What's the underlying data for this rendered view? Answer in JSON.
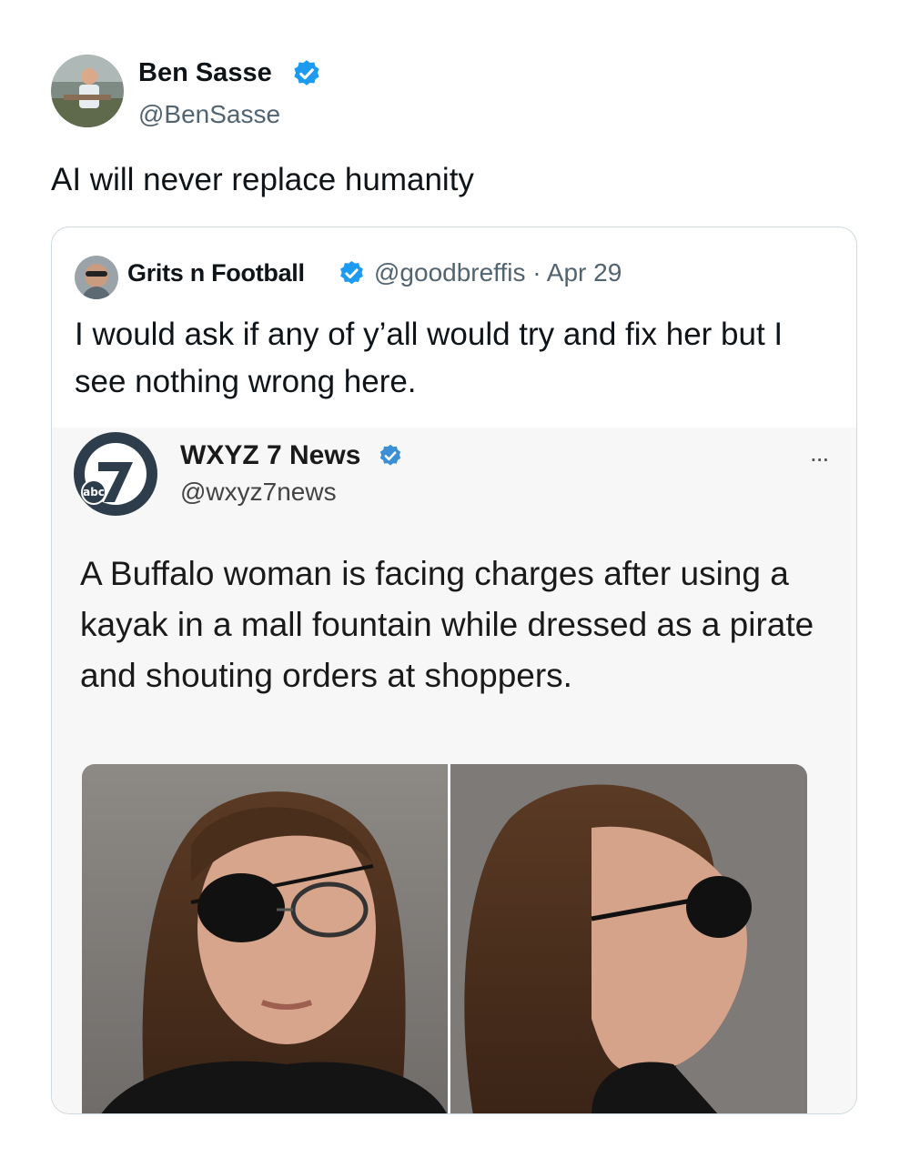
{
  "tweet": {
    "author_name": "Ben Sasse",
    "author_handle": "@BenSasse",
    "text": "AI will never replace humanity",
    "verified_color": "#1d9bf0"
  },
  "quoted_tweet": {
    "author_name": "Grits n Football",
    "handle_and_date": "@goodbreffis · Apr 29",
    "text": "I would ask if any of y’all would try and fix her but I see nothing wrong here."
  },
  "embedded_post": {
    "author_name": "WXYZ 7 News",
    "author_handle": "@wxyz7news",
    "logo_small_text": "abc",
    "more_label": "...",
    "text": "A Buffalo woman is facing charges after using a kayak in a mall fountain while dressed as a pirate and shouting orders at shoppers.",
    "verified_color": "#3a8fd6"
  }
}
